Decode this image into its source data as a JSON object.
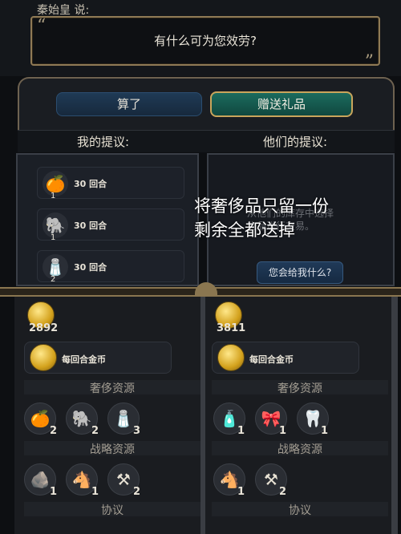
{
  "speech": {
    "speaker": "秦始皇 说:",
    "text": "有什么可为您效劳?",
    "quote_open": "“",
    "quote_close": "”"
  },
  "buttons": {
    "cancel": "算了",
    "gift": "赠送礼品",
    "ask": "您会给我什么?"
  },
  "headers": {
    "mine": "我的提议:",
    "theirs": "他们的提议:"
  },
  "my_offer": [
    {
      "icon": "orange-icon",
      "label": "30 回合",
      "count": "1"
    },
    {
      "icon": "elephant-icon",
      "label": "30 回合",
      "count": "1"
    },
    {
      "icon": "salt-icon",
      "label": "30 回合",
      "count": "2"
    }
  ],
  "their_offer_placeholder": [
    "从他们的库存中选择",
    "物品进行交易。"
  ],
  "overlay": [
    "将奢侈品只留一份",
    "剩余全都送掉"
  ],
  "left_inventory": {
    "gold": "2892",
    "per_turn_label": "每回合金币",
    "luxury_title": "奢侈资源",
    "luxury": [
      {
        "icon": "orange-icon",
        "count": "2"
      },
      {
        "icon": "elephant-icon",
        "count": "2"
      },
      {
        "icon": "salt-icon",
        "count": "3"
      }
    ],
    "strategic_title": "战略资源",
    "strategic": [
      {
        "icon": "coal-icon",
        "count": "1"
      },
      {
        "icon": "horse-icon",
        "count": "1"
      },
      {
        "icon": "iron-icon",
        "count": "2"
      }
    ],
    "agreements_title": "协议"
  },
  "right_inventory": {
    "gold": "3811",
    "per_turn_label": "每回合金币",
    "luxury_title": "奢侈资源",
    "luxury": [
      {
        "icon": "perfume-icon",
        "count": "1"
      },
      {
        "icon": "silk-icon",
        "count": "1"
      },
      {
        "icon": "ivory-item-icon",
        "count": "1"
      }
    ],
    "strategic_title": "战略资源",
    "strategic": [
      {
        "icon": "horse-icon",
        "count": "1"
      },
      {
        "icon": "iron-icon",
        "count": "2"
      }
    ],
    "agreements_title": "协议"
  },
  "colors": {
    "gift_button": "#1b6b5e",
    "gold_border": "#c9a55b",
    "cancel_button": "#1f3a55"
  }
}
